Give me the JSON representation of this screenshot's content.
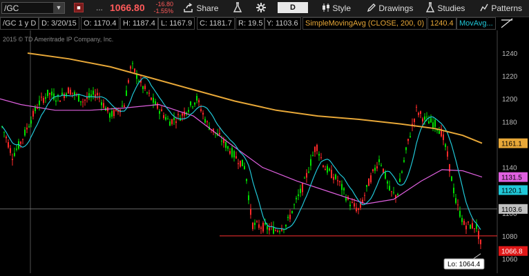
{
  "toolbar": {
    "symbol": "/GC",
    "flag_icon": "flag-icon",
    "dots": "...",
    "last_price": "1066.80",
    "net_change": "-16.80",
    "pct_change": "-1.55%",
    "share_label": "Share",
    "period": "D",
    "style_label": "Style",
    "drawings_label": "Drawings",
    "studies_label": "Studies",
    "patterns_label": "Patterns"
  },
  "info_bar": {
    "chart_label": "/GC 1 y D",
    "date": "D: 3/20/15",
    "open": "O: 1170.4",
    "high": "H: 1187.4",
    "low": "L: 1167.9",
    "close": "C: 1181.7",
    "range": "R: 19.5",
    "y": "Y: 1103.6",
    "study": "SimpleMovingAvg (CLOSE, 200, 0)",
    "study_value": "1240.4",
    "study2": "MovAvg..."
  },
  "copyright": "2015 © TD Ameritrade IP Company, Inc.",
  "colors": {
    "up": "#00e000",
    "down": "#ff2a2a",
    "sma200": "#e8a838",
    "ma_magenta": "#e060e0",
    "ma_cyan": "#20c8d8",
    "axis_text": "#bbbbbb"
  },
  "chart_data": {
    "type": "candlestick",
    "y_ticks": [
      "1240",
      "1220",
      "1200",
      "1180",
      "1160",
      "1140",
      "1120",
      "1100",
      "1080",
      "1060"
    ],
    "ylim": [
      1050,
      1250
    ],
    "price_labels": [
      {
        "text": "1161.1",
        "value": 1161.1,
        "color": "#e8a838"
      },
      {
        "text": "1131.5",
        "value": 1131.5,
        "color": "#e060e0"
      },
      {
        "text": "1120.1",
        "value": 1120.1,
        "color": "#20c8d8"
      },
      {
        "text": "1103.6",
        "value": 1103.6,
        "color": "#c0c0c0"
      },
      {
        "text": "1066.8",
        "value": 1066.8,
        "color": "#e01818"
      }
    ],
    "crosshair_y": 1103.6,
    "support_line": 1080,
    "low_label": "Lo: 1064.4",
    "low_value": 1064.4
  }
}
